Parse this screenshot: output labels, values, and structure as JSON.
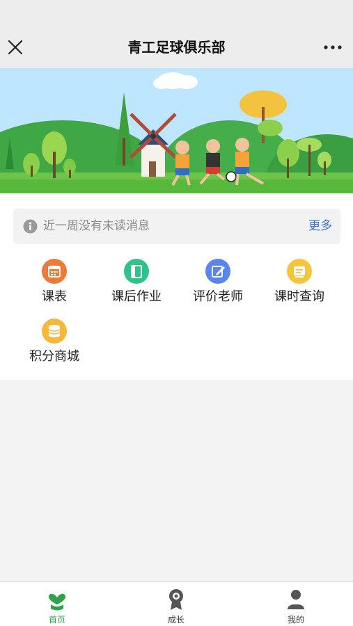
{
  "header": {
    "title": "青工足球俱乐部",
    "close_icon": "close-icon",
    "more_icon": "more-dots-icon"
  },
  "banner": {
    "image": "football-kids-banner",
    "description_icon": "banner-illustration"
  },
  "notice": {
    "icon": "info-icon",
    "text": "近一周没有未读消息",
    "more_label": "更多"
  },
  "menu": {
    "items": [
      {
        "label": "课表",
        "icon": "calendar-icon",
        "color": "#ec7a3a"
      },
      {
        "label": "课后作业",
        "icon": "book-icon",
        "color": "#2fc38a"
      },
      {
        "label": "评价老师",
        "icon": "edit-icon",
        "color": "#5b85ee"
      },
      {
        "label": "课时查询",
        "icon": "receipt-icon",
        "color": "#f5c63b"
      },
      {
        "label": "积分商城",
        "icon": "coins-icon",
        "color": "#f5b83b"
      }
    ]
  },
  "tabbar": {
    "tabs": [
      {
        "label": "首页",
        "icon": "home-heart-icon",
        "active": true
      },
      {
        "label": "成长",
        "icon": "medal-icon",
        "active": false
      },
      {
        "label": "我的",
        "icon": "user-icon",
        "active": false
      }
    ]
  },
  "colors": {
    "accent": "#2fa24a",
    "link": "#3b73c9"
  }
}
